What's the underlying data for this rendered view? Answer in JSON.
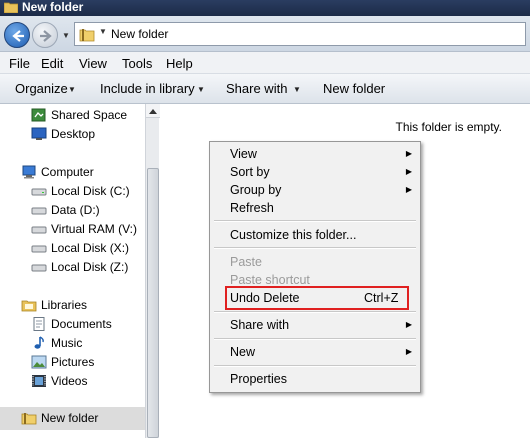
{
  "window": {
    "title": "New folder"
  },
  "address": {
    "crumb": "New folder"
  },
  "menubar": {
    "items": [
      "File",
      "Edit",
      "View",
      "Tools",
      "Help"
    ]
  },
  "command_bar": {
    "organize": "Organize",
    "include_in_library": "Include in library",
    "share_with": "Share with",
    "new_folder": "New folder"
  },
  "nav_pane": {
    "favorites": [
      "Shared Space",
      "Desktop"
    ],
    "computer": {
      "label": "Computer",
      "drives": [
        "Local Disk (C:)",
        "Data (D:)",
        "Virtual RAM (V:)",
        "Local Disk (X:)",
        "Local Disk (Z:)"
      ]
    },
    "libraries": {
      "label": "Libraries",
      "items": [
        "Documents",
        "Music",
        "Pictures",
        "Videos"
      ]
    },
    "selected": "New folder"
  },
  "content": {
    "empty_message": "This folder is empty."
  },
  "context_menu": {
    "view": "View",
    "sort_by": "Sort by",
    "group_by": "Group by",
    "refresh": "Refresh",
    "customize": "Customize this folder...",
    "paste": "Paste",
    "paste_shortcut": "Paste shortcut",
    "undo_delete": "Undo Delete",
    "undo_shortcut": "Ctrl+Z",
    "share_with": "Share with",
    "new": "New",
    "properties": "Properties"
  },
  "colors": {
    "highlight_box": "#e02020",
    "title_bar": "#1c2a47",
    "nav_selected": "#dcdcdc"
  }
}
